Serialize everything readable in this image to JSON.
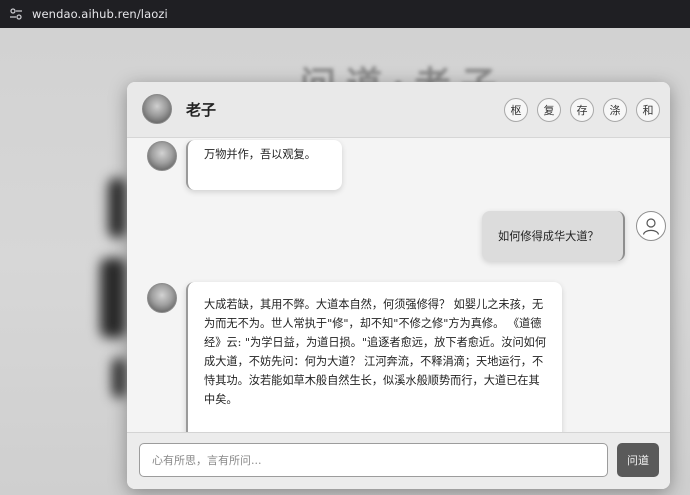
{
  "browser": {
    "url": "wendao.aihub.ren/laozi"
  },
  "background": {
    "title": "问道·老子"
  },
  "chat": {
    "header": {
      "name": "老子",
      "buttons": [
        "枢",
        "复",
        "存",
        "涤",
        "和"
      ]
    },
    "messages": [
      {
        "role": "assistant",
        "text": "万物并作，吾以观复。"
      },
      {
        "role": "user",
        "text": "如何修得成华大道？"
      },
      {
        "role": "assistant",
        "text": "大成若缺，其用不弊。大道本自然，何须强修得？ 如婴儿之未孩，无为而无不为。世人常执于\"修\"，却不知\"不修之修\"方为真修。 《道德经》云: \"为学日益，为道日损。\"追逐者愈远，放下者愈近。汝问如何成大道，不妨先问：何为大道？ 江河奔流，不释涓滴；天地运行，不恃其功。汝若能如草木般自然生长，似溪水般顺势而行，大道已在其中矣。"
      }
    ],
    "input": {
      "placeholder": "心有所思，言有所问...",
      "value": ""
    },
    "send_label": "问道"
  }
}
